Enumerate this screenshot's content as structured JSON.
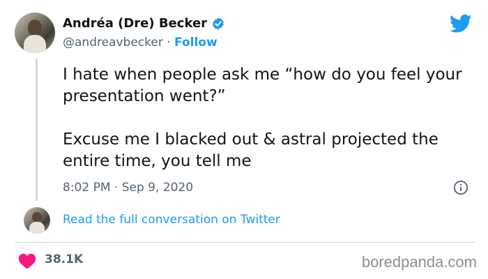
{
  "author": {
    "display_name": "Andréa (Dre) Becker",
    "handle": "@andreavbecker",
    "separator": " · ",
    "follow_label": "Follow"
  },
  "tweet": {
    "text": "I hate when people ask me “how do you feel your presentation went?”\n\nExcuse me I blacked out & astral projected the entire time, you tell me",
    "timestamp": "8:02 PM · Sep 9, 2020"
  },
  "reply": {
    "link_label": "Read the full conversation on Twitter"
  },
  "footer": {
    "likes": "38.1K",
    "watermark": "boredpanda.com"
  },
  "icons": {
    "brand": "twitter-bird-icon",
    "verified": "verified-badge-icon",
    "info": "info-icon",
    "like": "heart-icon"
  },
  "colors": {
    "accent": "#1d9bf0",
    "heart": "#f91880",
    "secondary_text": "#536471"
  }
}
